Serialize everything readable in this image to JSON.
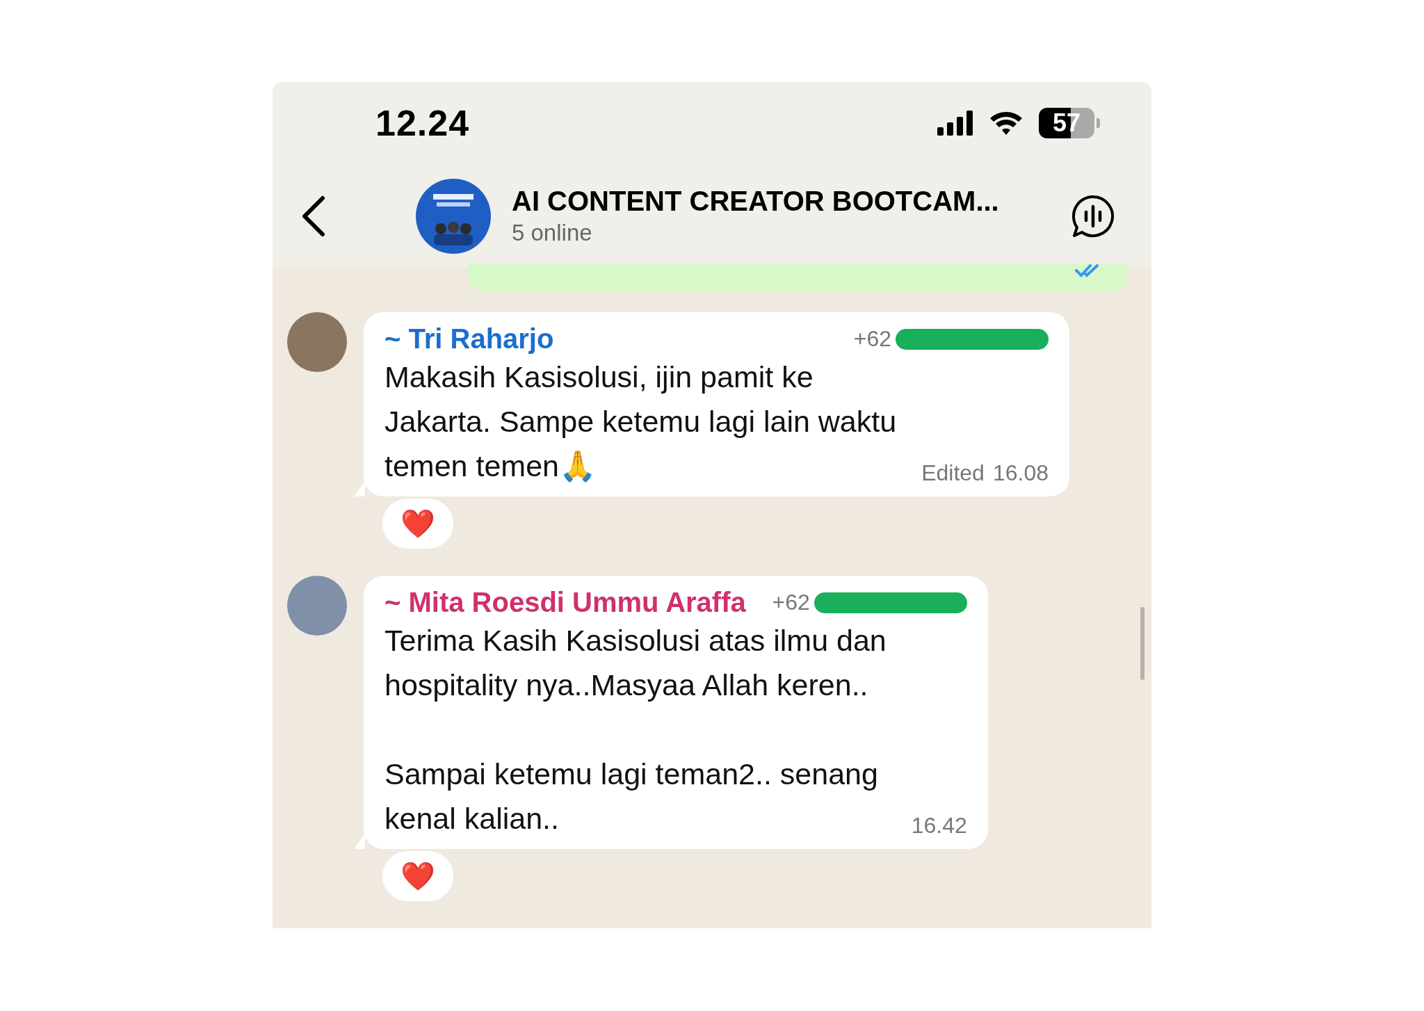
{
  "status_bar": {
    "time": "12.24",
    "battery": "57"
  },
  "header": {
    "title": "AI CONTENT CREATOR BOOTCAM...",
    "subtitle": "5 online"
  },
  "messages": [
    {
      "sender": "~ Tri Raharjo",
      "color": "#1a6fce",
      "phone": "+62",
      "text": "Makasih Kasisolusi, ijin pamit ke\nJakarta. Sampe ketemu lagi lain waktu\ntemen temen🙏",
      "edited_label": "Edited",
      "time": "16.08",
      "reaction": "❤️"
    },
    {
      "sender": "~ Mita Roesdi Ummu Araffa",
      "color": "#d0306d",
      "phone": "+62",
      "text": "Terima Kasih Kasisolusi atas ilmu dan\nhospitality nya..Masyaa Allah keren..\n\nSampai ketemu lagi teman2.. senang\nkenal kalian..",
      "time": "16.42",
      "reaction": "❤️"
    }
  ]
}
